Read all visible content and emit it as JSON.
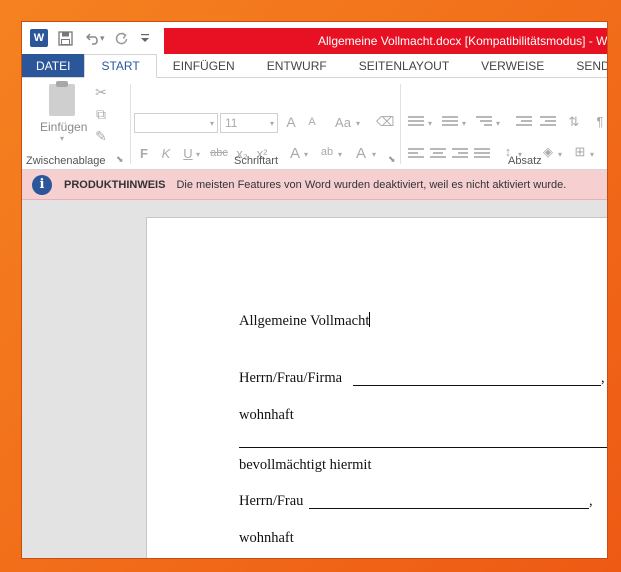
{
  "window": {
    "title": "Allgemeine Vollmacht.docx [Kompatibilitätsmodus] -  W"
  },
  "quick_access": {
    "app_icon": "word-icon",
    "app_letter": "W",
    "save_icon": "save-icon",
    "undo_icon": "undo-icon",
    "redo_icon": "redo-icon",
    "customize_icon": "customize-qat-icon"
  },
  "ribbon_tabs": [
    {
      "label": "DATEI"
    },
    {
      "label": "START"
    },
    {
      "label": "EINFÜGEN"
    },
    {
      "label": "ENTWURF"
    },
    {
      "label": "SEITENLAYOUT"
    },
    {
      "label": "VERWEISE"
    },
    {
      "label": "SENDUNGEN"
    }
  ],
  "ribbon": {
    "clipboard": {
      "paste_label": "Einfügen",
      "group_label": "Zwischenablage"
    },
    "font": {
      "font_name": "",
      "font_size": "11",
      "bold": "F",
      "italic": "K",
      "underline": "U",
      "strikethrough": "abc",
      "subscript": "x₂",
      "superscript": "x²",
      "grow": "A",
      "shrink": "A",
      "case": "Aa",
      "effects": "A",
      "highlight": "ab",
      "color": "A",
      "group_label": "Schriftart"
    },
    "paragraph": {
      "group_label": "Absatz"
    }
  },
  "infobar": {
    "title": "PRODUKTHINWEIS",
    "message": "Die meisten Features von Word wurden deaktiviert, weil es nicht aktiviert wurde."
  },
  "document": {
    "heading": "Allgemeine Vollmacht",
    "line1_label": "Herrn/Frau/Firma",
    "line1_end": ",",
    "line2_label": "wohnhaft",
    "line3_label": "bevollmächtigt hiermit",
    "line4_label": "Herrn/Frau",
    "line4_end": ",",
    "line5_label": "wohnhaft"
  }
}
